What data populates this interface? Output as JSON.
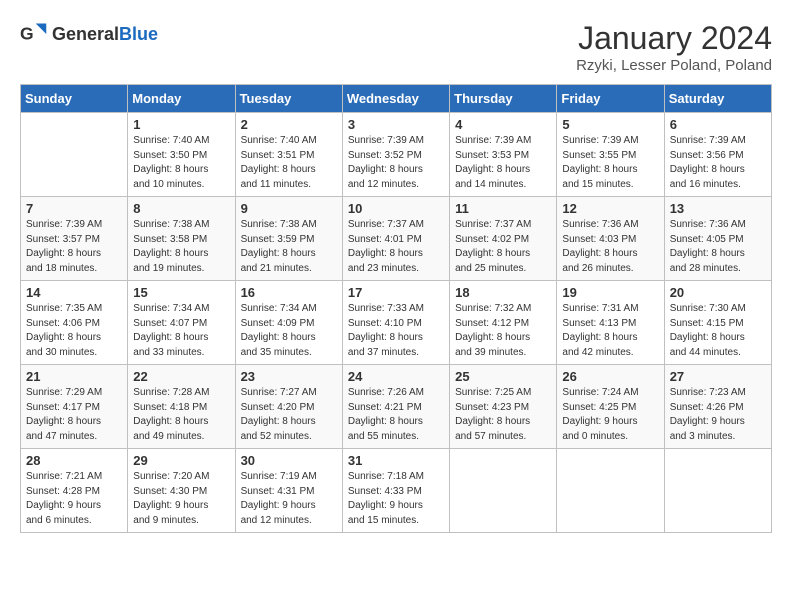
{
  "header": {
    "logo_general": "General",
    "logo_blue": "Blue",
    "title": "January 2024",
    "subtitle": "Rzyki, Lesser Poland, Poland"
  },
  "days_of_week": [
    "Sunday",
    "Monday",
    "Tuesday",
    "Wednesday",
    "Thursday",
    "Friday",
    "Saturday"
  ],
  "weeks": [
    [
      {
        "day": "",
        "info": ""
      },
      {
        "day": "1",
        "info": "Sunrise: 7:40 AM\nSunset: 3:50 PM\nDaylight: 8 hours\nand 10 minutes."
      },
      {
        "day": "2",
        "info": "Sunrise: 7:40 AM\nSunset: 3:51 PM\nDaylight: 8 hours\nand 11 minutes."
      },
      {
        "day": "3",
        "info": "Sunrise: 7:39 AM\nSunset: 3:52 PM\nDaylight: 8 hours\nand 12 minutes."
      },
      {
        "day": "4",
        "info": "Sunrise: 7:39 AM\nSunset: 3:53 PM\nDaylight: 8 hours\nand 14 minutes."
      },
      {
        "day": "5",
        "info": "Sunrise: 7:39 AM\nSunset: 3:55 PM\nDaylight: 8 hours\nand 15 minutes."
      },
      {
        "day": "6",
        "info": "Sunrise: 7:39 AM\nSunset: 3:56 PM\nDaylight: 8 hours\nand 16 minutes."
      }
    ],
    [
      {
        "day": "7",
        "info": "Sunrise: 7:39 AM\nSunset: 3:57 PM\nDaylight: 8 hours\nand 18 minutes."
      },
      {
        "day": "8",
        "info": "Sunrise: 7:38 AM\nSunset: 3:58 PM\nDaylight: 8 hours\nand 19 minutes."
      },
      {
        "day": "9",
        "info": "Sunrise: 7:38 AM\nSunset: 3:59 PM\nDaylight: 8 hours\nand 21 minutes."
      },
      {
        "day": "10",
        "info": "Sunrise: 7:37 AM\nSunset: 4:01 PM\nDaylight: 8 hours\nand 23 minutes."
      },
      {
        "day": "11",
        "info": "Sunrise: 7:37 AM\nSunset: 4:02 PM\nDaylight: 8 hours\nand 25 minutes."
      },
      {
        "day": "12",
        "info": "Sunrise: 7:36 AM\nSunset: 4:03 PM\nDaylight: 8 hours\nand 26 minutes."
      },
      {
        "day": "13",
        "info": "Sunrise: 7:36 AM\nSunset: 4:05 PM\nDaylight: 8 hours\nand 28 minutes."
      }
    ],
    [
      {
        "day": "14",
        "info": "Sunrise: 7:35 AM\nSunset: 4:06 PM\nDaylight: 8 hours\nand 30 minutes."
      },
      {
        "day": "15",
        "info": "Sunrise: 7:34 AM\nSunset: 4:07 PM\nDaylight: 8 hours\nand 33 minutes."
      },
      {
        "day": "16",
        "info": "Sunrise: 7:34 AM\nSunset: 4:09 PM\nDaylight: 8 hours\nand 35 minutes."
      },
      {
        "day": "17",
        "info": "Sunrise: 7:33 AM\nSunset: 4:10 PM\nDaylight: 8 hours\nand 37 minutes."
      },
      {
        "day": "18",
        "info": "Sunrise: 7:32 AM\nSunset: 4:12 PM\nDaylight: 8 hours\nand 39 minutes."
      },
      {
        "day": "19",
        "info": "Sunrise: 7:31 AM\nSunset: 4:13 PM\nDaylight: 8 hours\nand 42 minutes."
      },
      {
        "day": "20",
        "info": "Sunrise: 7:30 AM\nSunset: 4:15 PM\nDaylight: 8 hours\nand 44 minutes."
      }
    ],
    [
      {
        "day": "21",
        "info": "Sunrise: 7:29 AM\nSunset: 4:17 PM\nDaylight: 8 hours\nand 47 minutes."
      },
      {
        "day": "22",
        "info": "Sunrise: 7:28 AM\nSunset: 4:18 PM\nDaylight: 8 hours\nand 49 minutes."
      },
      {
        "day": "23",
        "info": "Sunrise: 7:27 AM\nSunset: 4:20 PM\nDaylight: 8 hours\nand 52 minutes."
      },
      {
        "day": "24",
        "info": "Sunrise: 7:26 AM\nSunset: 4:21 PM\nDaylight: 8 hours\nand 55 minutes."
      },
      {
        "day": "25",
        "info": "Sunrise: 7:25 AM\nSunset: 4:23 PM\nDaylight: 8 hours\nand 57 minutes."
      },
      {
        "day": "26",
        "info": "Sunrise: 7:24 AM\nSunset: 4:25 PM\nDaylight: 9 hours\nand 0 minutes."
      },
      {
        "day": "27",
        "info": "Sunrise: 7:23 AM\nSunset: 4:26 PM\nDaylight: 9 hours\nand 3 minutes."
      }
    ],
    [
      {
        "day": "28",
        "info": "Sunrise: 7:21 AM\nSunset: 4:28 PM\nDaylight: 9 hours\nand 6 minutes."
      },
      {
        "day": "29",
        "info": "Sunrise: 7:20 AM\nSunset: 4:30 PM\nDaylight: 9 hours\nand 9 minutes."
      },
      {
        "day": "30",
        "info": "Sunrise: 7:19 AM\nSunset: 4:31 PM\nDaylight: 9 hours\nand 12 minutes."
      },
      {
        "day": "31",
        "info": "Sunrise: 7:18 AM\nSunset: 4:33 PM\nDaylight: 9 hours\nand 15 minutes."
      },
      {
        "day": "",
        "info": ""
      },
      {
        "day": "",
        "info": ""
      },
      {
        "day": "",
        "info": ""
      }
    ]
  ]
}
